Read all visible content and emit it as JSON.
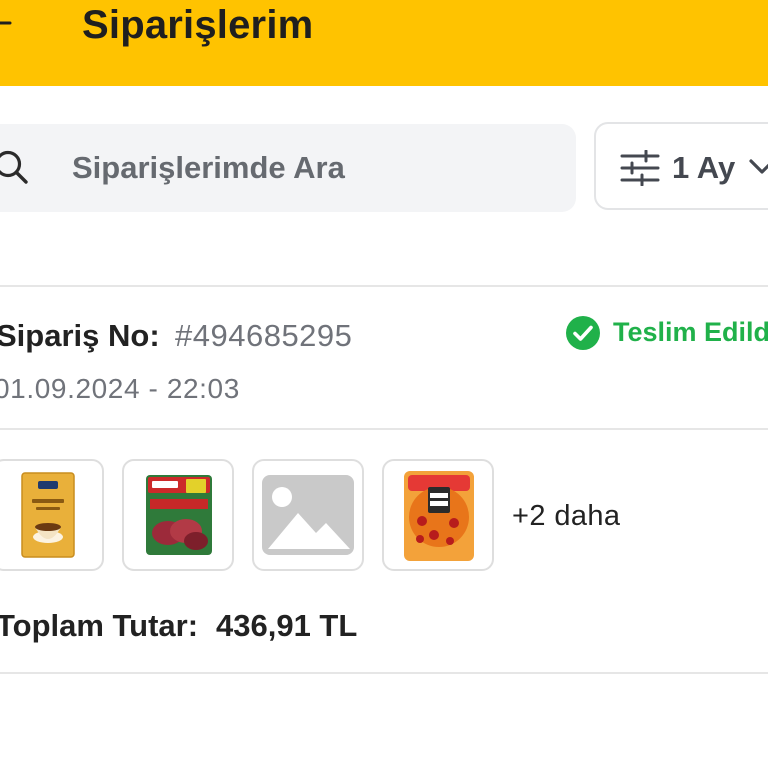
{
  "header": {
    "title": "Siparişlerim",
    "background_color": "#FFC300"
  },
  "search": {
    "placeholder": "Siparişlerimde Ara",
    "icon": "search-icon"
  },
  "filter": {
    "label": "1 Ay",
    "icon": "sliders-icon",
    "dropdown_icon": "chevron-down-icon"
  },
  "order": {
    "number_label": "Sipariş No:",
    "number_value": "#494685295",
    "date": "01.09.2024 - 22:03",
    "status": {
      "text": "Teslim Edildi",
      "color": "#20B14A",
      "icon": "check-circle-icon"
    },
    "items": [
      {
        "name": "thumb-coffee",
        "icon": "coffee-package-image"
      },
      {
        "name": "thumb-salami",
        "icon": "salami-package-image"
      },
      {
        "name": "thumb-placeholder",
        "icon": "image-placeholder-icon"
      },
      {
        "name": "thumb-pizza",
        "icon": "pizza-package-image"
      }
    ],
    "more_items_label": "+2 daha",
    "total_label": "Toplam Tutar:",
    "total_value": "436,91 TL"
  }
}
